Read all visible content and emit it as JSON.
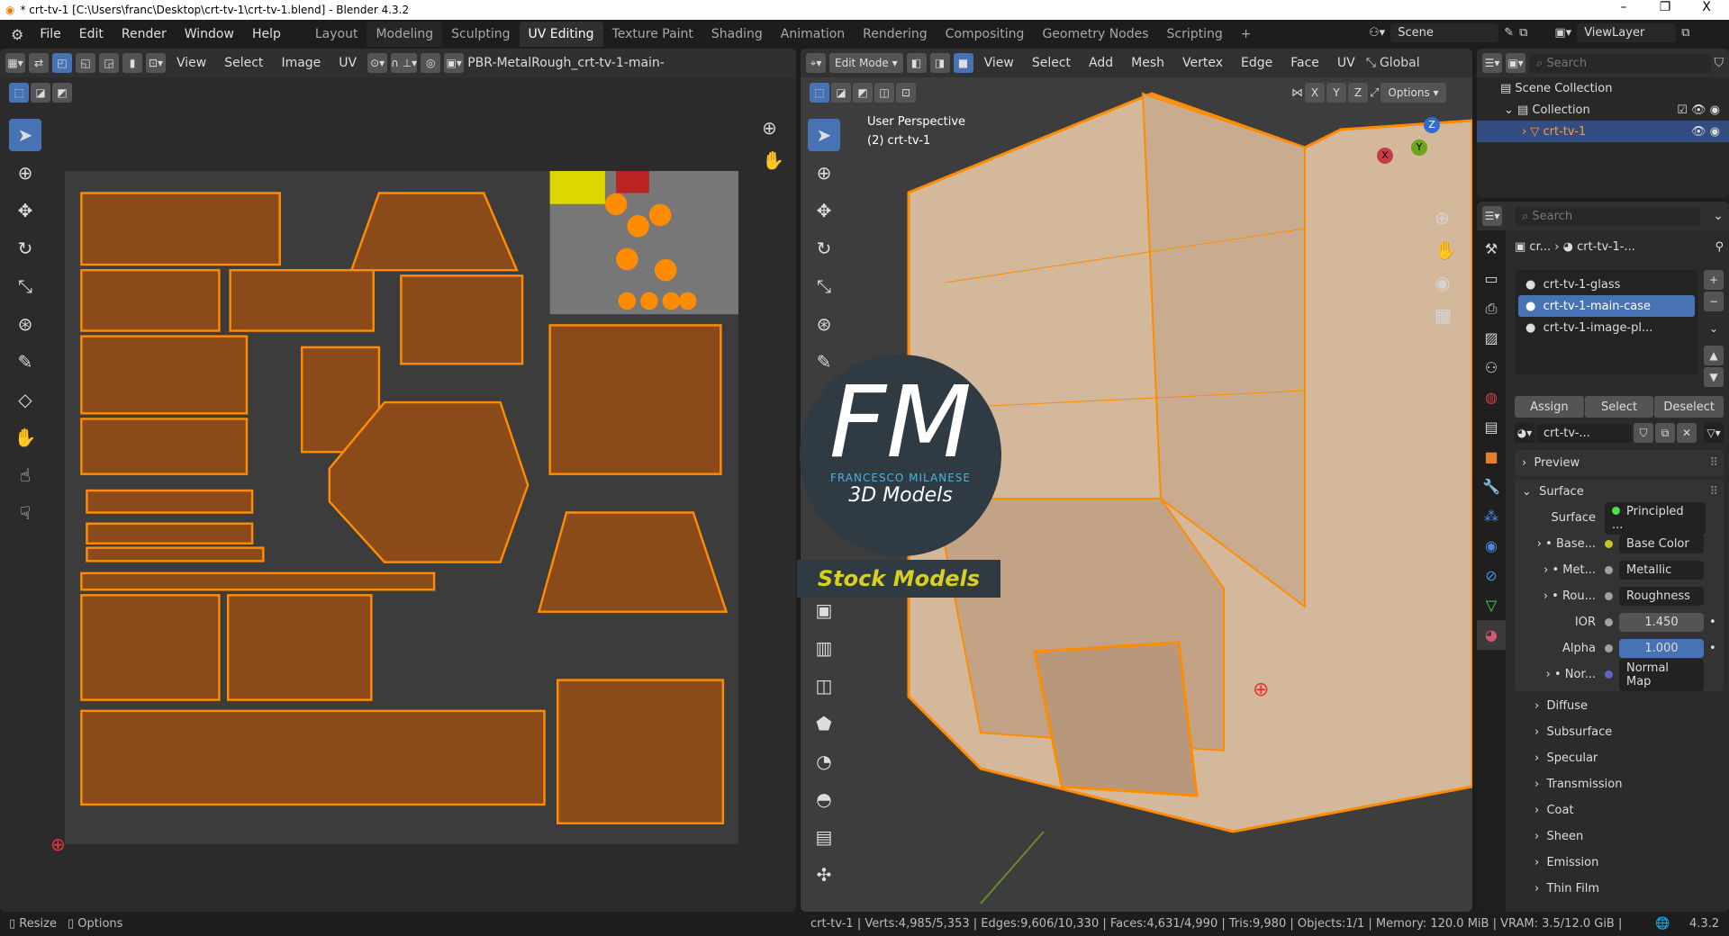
{
  "window": {
    "title": "* crt-tv-1 [C:\\Users\\franc\\Desktop\\crt-tv-1\\crt-tv-1.blend] - Blender 4.3.2",
    "minimize": "–",
    "maximize": "❐",
    "close": "X"
  },
  "menu": [
    "File",
    "Edit",
    "Render",
    "Window",
    "Help"
  ],
  "workspaces": [
    "Layout",
    "Modeling",
    "Sculpting",
    "UV Editing",
    "Texture Paint",
    "Shading",
    "Animation",
    "Rendering",
    "Compositing",
    "Geometry Nodes",
    "Scripting",
    "+"
  ],
  "active_workspace": "UV Editing",
  "scene": "Scene",
  "view_layer": "ViewLayer",
  "uv_editor": {
    "menus": [
      "View",
      "Select",
      "Image",
      "UV"
    ],
    "image_name": "PBR-MetalRough_crt-tv-1-main-"
  },
  "viewport": {
    "mode": "Edit Mode",
    "menus": [
      "View",
      "Select",
      "Add",
      "Mesh",
      "Vertex",
      "Edge",
      "Face",
      "UV"
    ],
    "orientation": "Global",
    "axes": [
      "X",
      "Y",
      "Z"
    ],
    "options": "Options",
    "overlay_title": "User Perspective",
    "overlay_object": "(2) crt-tv-1",
    "gizmo": {
      "x": "X",
      "y": "Y",
      "z": "Z"
    }
  },
  "watermark": {
    "logo": "FM",
    "brand": "FRANCESCO MILANESE",
    "sub": "3D Models",
    "banner": "Stock Models"
  },
  "outliner": {
    "search_placeholder": "Search",
    "scene_collection": "Scene Collection",
    "collection": "Collection",
    "object": "crt-tv-1"
  },
  "properties": {
    "search_placeholder": "Search",
    "breadcrumb": [
      "cr...",
      "crt-tv-1-..."
    ],
    "slots": [
      {
        "name": "crt-tv-1-glass",
        "selected": false
      },
      {
        "name": "crt-tv-1-main-case",
        "selected": true
      },
      {
        "name": "crt-tv-1-image-pl...",
        "selected": false
      }
    ],
    "slot_buttons": [
      "Assign",
      "Select",
      "Deselect"
    ],
    "material_name": "crt-tv-...",
    "panels": {
      "preview": "Preview",
      "surface": "Surface"
    },
    "surface_label": "Surface",
    "surface_value": "Principled ...",
    "inputs": [
      {
        "label": "Base...",
        "value": "Base Color",
        "socket": "#c7c729",
        "kind": "link"
      },
      {
        "label": "Met...",
        "value": "Metallic",
        "socket": "#a1a1a1",
        "kind": "link"
      },
      {
        "label": "Rou...",
        "value": "Roughness",
        "socket": "#a1a1a1",
        "kind": "link"
      },
      {
        "label": "IOR",
        "value": "1.450",
        "socket": "#a1a1a1",
        "kind": "number",
        "fill": 0
      },
      {
        "label": "Alpha",
        "value": "1.000",
        "socket": "#a1a1a1",
        "kind": "number",
        "fill": 1
      },
      {
        "label": "Nor...",
        "value": "Normal Map",
        "socket": "#6363c7",
        "kind": "link"
      }
    ],
    "subpanels": [
      "Diffuse",
      "Subsurface",
      "Specular",
      "Transmission",
      "Coat",
      "Sheen",
      "Emission",
      "Thin Film"
    ]
  },
  "status": {
    "left": [
      {
        "key": "Resize"
      },
      {
        "key": "Options"
      }
    ],
    "stats": "crt-tv-1 | Verts:4,985/5,353 | Edges:9,606/10,330 | Faces:4,631/4,990 | Tris:9,980 | Objects:1/1 | Memory: 120.0 MiB | VRAM: 3.5/12.0 GiB |",
    "version": "4.3.2"
  },
  "colors": {
    "accent": "#4772b3",
    "selection": "#ff8c00",
    "uv_fill": "#8a4a1a"
  }
}
